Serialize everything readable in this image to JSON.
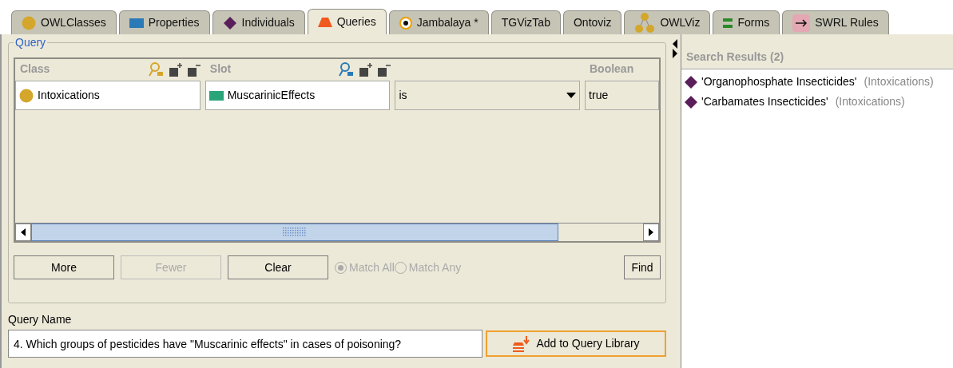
{
  "tabs": [
    {
      "label": "OWLClasses",
      "kind": "circle",
      "selected": false
    },
    {
      "label": "Properties",
      "kind": "rect",
      "selected": false
    },
    {
      "label": "Individuals",
      "kind": "diamond",
      "selected": false
    },
    {
      "label": "Queries",
      "kind": "trapezoid",
      "selected": true
    },
    {
      "label": "Jambalaya *",
      "kind": "target",
      "selected": false
    },
    {
      "label": "TGVizTab",
      "kind": "plain",
      "selected": false
    },
    {
      "label": "Ontoviz",
      "kind": "plain",
      "selected": false
    },
    {
      "label": "OWLViz",
      "kind": "nodes",
      "selected": false
    },
    {
      "label": "Forms",
      "kind": "bars",
      "selected": false
    },
    {
      "label": "SWRL Rules",
      "kind": "arrow",
      "selected": false
    }
  ],
  "query": {
    "title": "Query",
    "headers": [
      {
        "label": "Class",
        "kind": "class"
      },
      {
        "label": "Slot",
        "kind": "slot"
      },
      {
        "label": "Boolean",
        "kind": "value"
      }
    ],
    "row": {
      "class": "Intoxications",
      "slot": "MuscarinicEffects",
      "operator": "is",
      "value": "true"
    },
    "buttons": [
      {
        "label": "More",
        "disabled": false
      },
      {
        "label": "Fewer",
        "disabled": true
      },
      {
        "label": "Clear",
        "disabled": false
      }
    ],
    "match": [
      {
        "label": "Match All",
        "selected": true,
        "disabled": true
      },
      {
        "label": "Match Any",
        "selected": false,
        "disabled": true
      }
    ],
    "find": "Find"
  },
  "query_name": {
    "label": "Query Name",
    "value": "4. Which groups of pesticides have \"Muscarinic effects\" in cases of poisoning?",
    "button": "Add to Query Library"
  },
  "results": {
    "title": "Search Results (2)",
    "items": [
      {
        "name": "'Organophosphate Insecticides'",
        "class": "(Intoxications)"
      },
      {
        "name": "'Carbamates Insecticides'",
        "class": "(Intoxications)"
      }
    ]
  }
}
